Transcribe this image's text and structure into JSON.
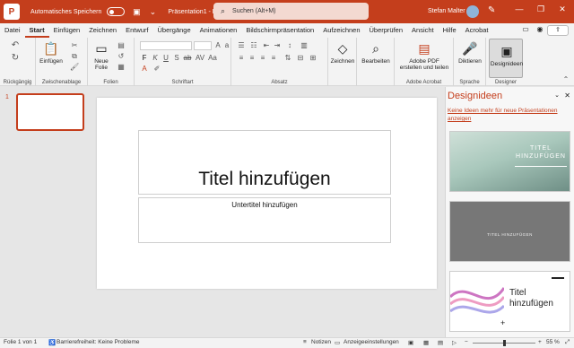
{
  "titlebar": {
    "app_icon": "P",
    "autosave_label": "Automatisches Speichern",
    "doc_title": "Präsentation1  -  PowerPoint",
    "search_placeholder": "Suchen (Alt+M)",
    "user_name": "Stefan Malter",
    "minimize": "—",
    "restore": "❐",
    "close": "✕"
  },
  "tabs": [
    "Datei",
    "Start",
    "Einfügen",
    "Zeichnen",
    "Entwurf",
    "Übergänge",
    "Animationen",
    "Bildschirmpräsentation",
    "Aufzeichnen",
    "Überprüfen",
    "Ansicht",
    "Hilfe",
    "Acrobat"
  ],
  "active_tab": "Start",
  "ribbon": {
    "groups": {
      "undo": "Rückgängig",
      "clipboard": "Zwischenablage",
      "slides": "Folien",
      "font": "Schriftart",
      "paragraph": "Absatz",
      "adobe": "Adobe Acrobat",
      "voice": "Sprache",
      "designer": "Designer"
    },
    "buttons": {
      "paste": "Einfügen",
      "new_slide_1": "Neue",
      "new_slide_2": "Folie",
      "draw": "Zeichnen",
      "edit": "Bearbeiten",
      "adobe_pdf_1": "Adobe PDF",
      "adobe_pdf_2": "erstellen und teilen",
      "dictate": "Diktieren",
      "designer": "Designideen"
    },
    "font_controls": [
      "F",
      "K",
      "U",
      "S",
      "ab",
      "AV",
      "Aa",
      "A"
    ]
  },
  "thumbnails": {
    "slide_number": "1"
  },
  "slide": {
    "title_placeholder": "Titel hinzufügen",
    "subtitle_placeholder": "Untertitel hinzufügen"
  },
  "designer_pane": {
    "title": "Designideen",
    "link": "Keine Ideen mehr für neue Präsentationen anzeigen",
    "card1_title": "TITEL HINZUFÜGEN",
    "card2_title": "TITEL HINZUFÜGEN",
    "card3_title": "Titel hinzufügen"
  },
  "statusbar": {
    "slide_info": "Folie 1 von 1",
    "accessibility": "Barrierefreiheit: Keine Probleme",
    "notes": "Notizen",
    "display_settings": "Anzeigeeinstellungen",
    "zoom": "55 %"
  },
  "colors": {
    "brand": "#c43e1c",
    "ribbon_bg": "#f3f3f3",
    "canvas_bg": "#e6e6e6"
  }
}
